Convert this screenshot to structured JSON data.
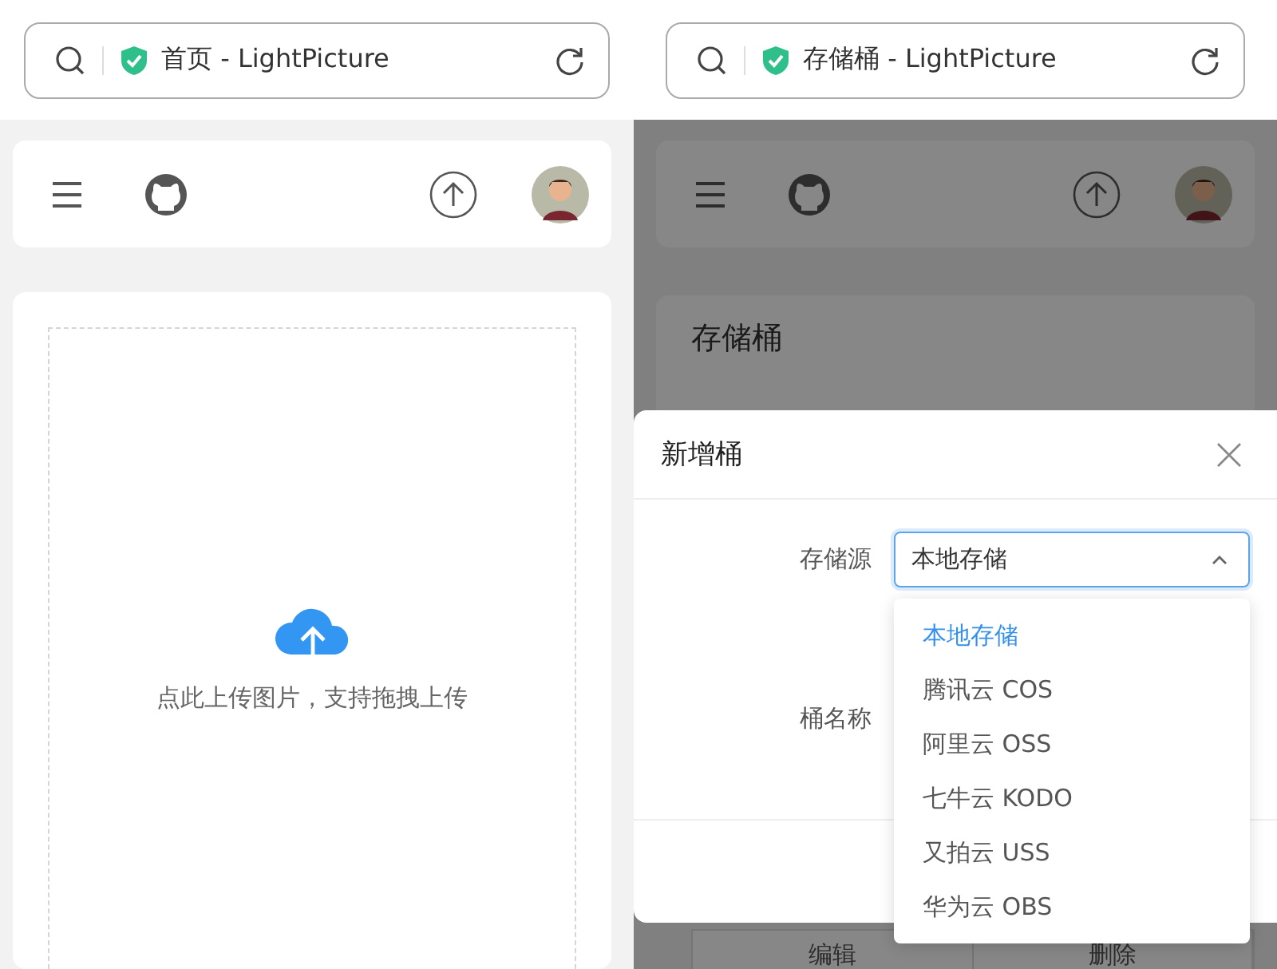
{
  "left": {
    "browser_title": "首页 - LightPicture",
    "upload_hint": "点此上传图片，支持拖拽上传"
  },
  "right": {
    "browser_title": "存储桶 - LightPicture",
    "page_title": "存储桶",
    "dialog": {
      "title": "新增桶",
      "source_label": "存储源",
      "source_value": "本地存储",
      "expanded": true,
      "name_label": "桶名称",
      "options": [
        {
          "label": "本地存储",
          "selected": true
        },
        {
          "label": "腾讯云 COS",
          "selected": false
        },
        {
          "label": "阿里云 OSS",
          "selected": false
        },
        {
          "label": "七牛云 KODO",
          "selected": false
        },
        {
          "label": "又拍云 USS",
          "selected": false
        },
        {
          "label": "华为云 OBS",
          "selected": false
        }
      ]
    },
    "table_actions": [
      "编辑",
      "删除"
    ]
  }
}
